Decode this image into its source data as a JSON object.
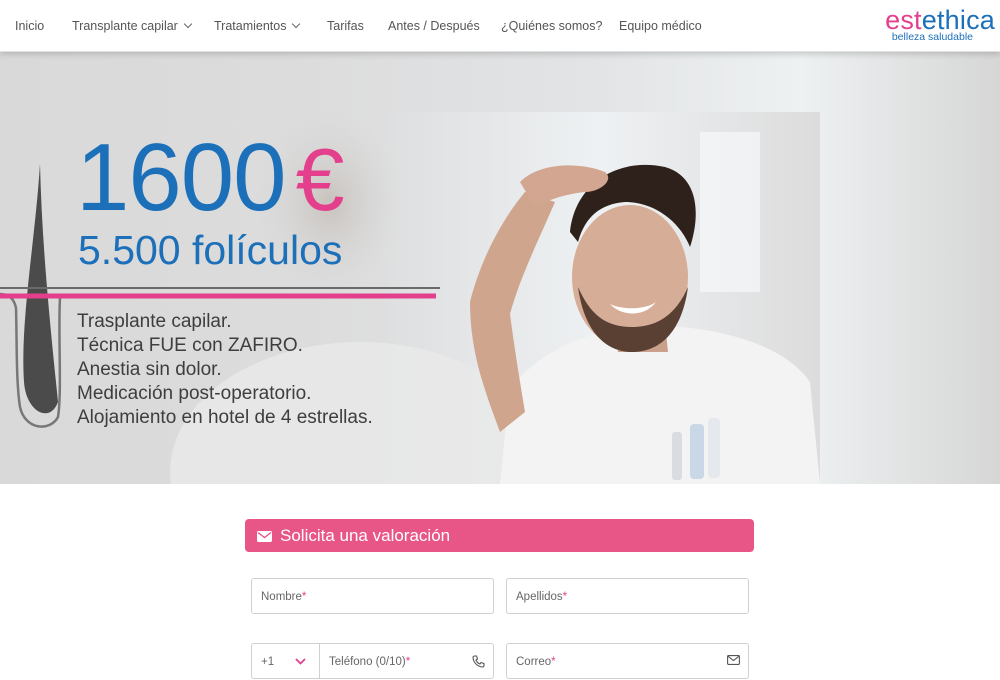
{
  "nav": {
    "items": [
      {
        "label": "Inicio",
        "has_dropdown": false
      },
      {
        "label": "Transplante capilar",
        "has_dropdown": true
      },
      {
        "label": "Tratamientos",
        "has_dropdown": true
      },
      {
        "label": "Tarifas",
        "has_dropdown": false
      },
      {
        "label": "Antes / Después",
        "has_dropdown": false
      },
      {
        "label": "¿Quiénes somos?",
        "has_dropdown": false
      },
      {
        "label": "Equipo médico",
        "has_dropdown": false
      }
    ]
  },
  "logo": {
    "part_pink": "est",
    "part_blue": "ethica",
    "tagline": "belleza saludable"
  },
  "hero": {
    "price": "1600",
    "currency": "€",
    "follicles": "5.500 folículos",
    "features": [
      "Trasplante capilar.",
      "Técnica FUE con ZAFIRO.",
      "Anestia sin dolor.",
      "Medicación post-operatorio.",
      "Alojamiento en hotel de 4 estrellas."
    ]
  },
  "form": {
    "title": "Solicita una valoración",
    "fields": {
      "first_name": "Nombre",
      "last_name": "Apellidos",
      "country_code": "+1",
      "phone": "Teléfono (0/10)",
      "email": "Correo"
    },
    "required_mark": "*"
  },
  "colors": {
    "brand_blue": "#1c6fb9",
    "brand_pink": "#e43f8c",
    "form_header": "#e85687"
  }
}
